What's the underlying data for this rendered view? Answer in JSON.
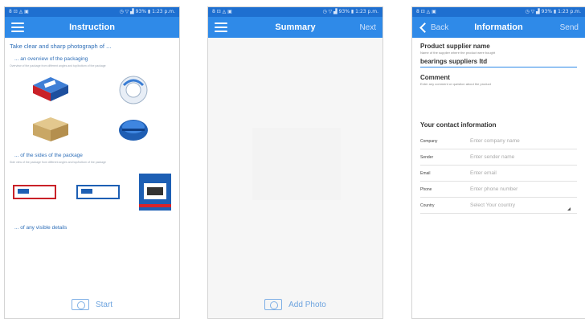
{
  "status": {
    "left": "8 ⊡ ◬ ▣",
    "right": "◷ ▽ ▟ 93% ▮ 1:23 p.m."
  },
  "panel1": {
    "title": "Instruction",
    "heading": "Take clear and sharp photograph of ...",
    "section1": "... an overview of the packaging",
    "section1_hint": "Overview of the package from different angles and top/bottom of the package",
    "section2": "... of the sides of the package",
    "section2_hint": "Side view of the package from different angles and top/bottom of the package",
    "section3": "... of any visible details",
    "start_label": "Start"
  },
  "panel2": {
    "title": "Summary",
    "next_label": "Next",
    "add_photo_label": "Add Photo"
  },
  "panel3": {
    "back_label": "Back",
    "title": "Information",
    "send_label": "Send",
    "supplier_label": "Product supplier name",
    "supplier_hint": "Name of the supplier where the product were bought",
    "supplier_value": "bearings suppliers ltd",
    "comment_label": "Comment",
    "comment_hint": "Enter any comment or question about the product",
    "contact_heading": "Your contact information",
    "fields": [
      {
        "label": "Company",
        "placeholder": "Enter company name"
      },
      {
        "label": "Sender",
        "placeholder": "Enter sender name"
      },
      {
        "label": "Email",
        "placeholder": "Enter email"
      },
      {
        "label": "Phone",
        "placeholder": "Enter phone number"
      },
      {
        "label": "Country",
        "placeholder": "Select Your country"
      }
    ]
  },
  "colors": {
    "appbar": "#2f8ae8",
    "statusbar": "#1e6fd0",
    "brand_blue": "#1d5fb4",
    "brand_red": "#d8232a"
  }
}
